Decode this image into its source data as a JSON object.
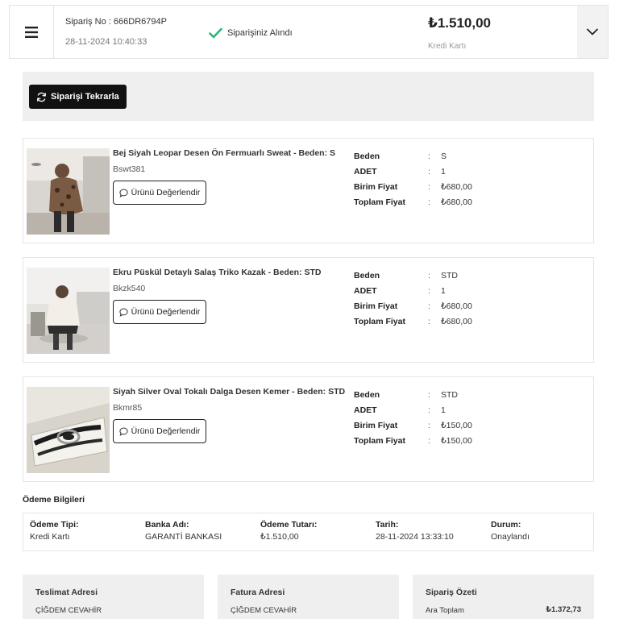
{
  "header": {
    "order_no": "Sipariş No : 666DR6794P",
    "order_date": "28-11-2024 10:40:33",
    "status": "Siparişiniz Alındı",
    "total": "₺1.510,00",
    "payment_method": "Kredi Kartı"
  },
  "reorder": {
    "label": "Siparişi Tekrarla"
  },
  "spec_labels": {
    "size": "Beden",
    "qty": "ADET",
    "unit_price": "Birim Fiyat",
    "total_price": "Toplam Fiyat",
    "colon": ":"
  },
  "products": [
    {
      "name": "Bej Siyah Leopar Desen Ön Fermuarlı Sweat - Beden: S",
      "code": "Bswt381",
      "review_label": "Ürünü Değerlendir",
      "size": "S",
      "qty": "1",
      "unit_price": "₺680,00",
      "total_price": "₺680,00"
    },
    {
      "name": "Ekru Püskül Detaylı Salaş Triko Kazak - Beden: STD",
      "code": "Bkzk540",
      "review_label": "Ürünü Değerlendir",
      "size": "STD",
      "qty": "1",
      "unit_price": "₺680,00",
      "total_price": "₺680,00"
    },
    {
      "name": "Siyah Silver Oval Tokalı Dalga Desen Kemer - Beden: STD",
      "code": "Bkmr85",
      "review_label": "Ürünü Değerlendir",
      "size": "STD",
      "qty": "1",
      "unit_price": "₺150,00",
      "total_price": "₺150,00"
    }
  ],
  "payment": {
    "title": "Ödeme Bilgileri",
    "columns": [
      {
        "label": "Ödeme Tipi:",
        "value": "Kredi Kartı"
      },
      {
        "label": "Banka Adı:",
        "value": "GARANTİ BANKASI"
      },
      {
        "label": "Ödeme Tutarı:",
        "value": "₺1.510,00"
      },
      {
        "label": "Tarih:",
        "value": "28-11-2024 13:33:10"
      },
      {
        "label": "Durum:",
        "value": "Onaylandı"
      }
    ]
  },
  "panels": {
    "shipping": {
      "title": "Teslimat Adresi",
      "name": "ÇİĞDEM CEVAHİR"
    },
    "billing": {
      "title": "Fatura Adresi",
      "name": "ÇİĞDEM CEVAHİR"
    },
    "summary": {
      "title": "Sipariş Özeti",
      "subtotal_label": "Ara Toplam",
      "subtotal_value": "₺1.372,73"
    }
  },
  "colors": {
    "accent_check": "#2bb673",
    "button_dark": "#111111",
    "panel_bg": "#efefef"
  },
  "icons": [
    "hamburger-icon",
    "check-icon",
    "chevron-down-icon",
    "refresh-icon",
    "comment-icon"
  ]
}
